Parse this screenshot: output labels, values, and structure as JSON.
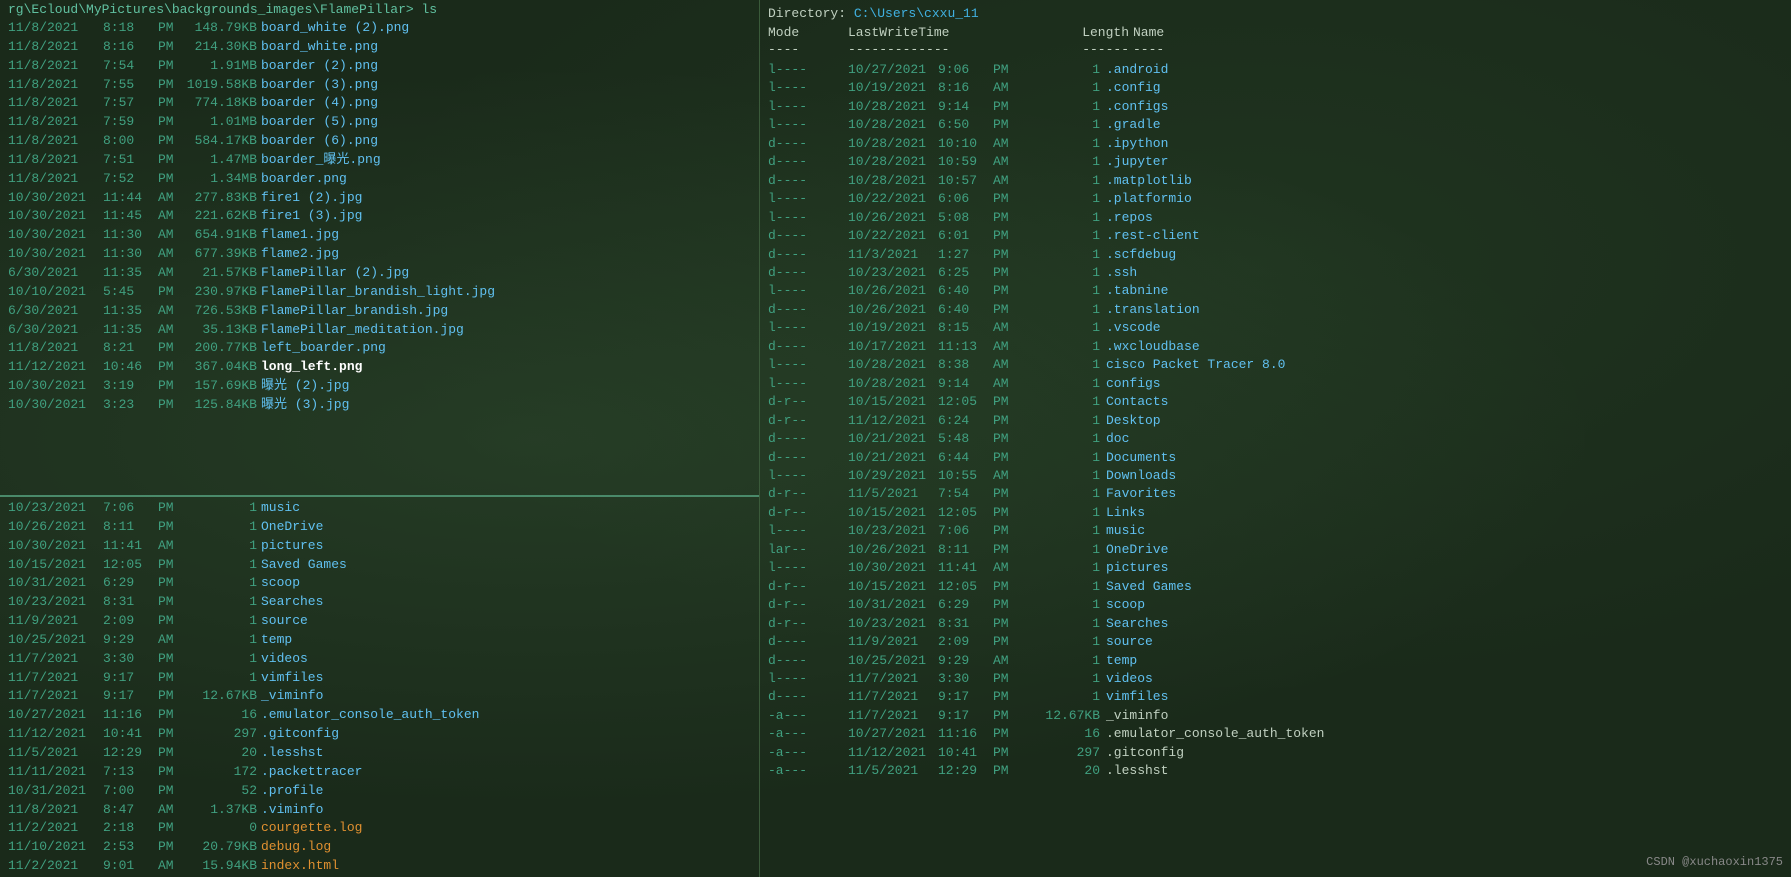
{
  "left_top": {
    "header": "rg\\Ecloud\\MyPictures\\backgrounds_images\\FlamePillar> ls",
    "files": [
      {
        "date": "11/8/2021",
        "time": "8:18",
        "ampm": "PM",
        "size": "148.79KB",
        "name": "board_white (2).png",
        "bold": false,
        "orange": false
      },
      {
        "date": "11/8/2021",
        "time": "8:16",
        "ampm": "PM",
        "size": "214.30KB",
        "name": "board_white.png",
        "bold": false,
        "orange": false
      },
      {
        "date": "11/8/2021",
        "time": "7:54",
        "ampm": "PM",
        "size": "1.91MB",
        "name": "boarder (2).png",
        "bold": false,
        "orange": false
      },
      {
        "date": "11/8/2021",
        "time": "7:55",
        "ampm": "PM",
        "size": "1019.58KB",
        "name": "boarder (3).png",
        "bold": false,
        "orange": false
      },
      {
        "date": "11/8/2021",
        "time": "7:57",
        "ampm": "PM",
        "size": "774.18KB",
        "name": "boarder (4).png",
        "bold": false,
        "orange": false
      },
      {
        "date": "11/8/2021",
        "time": "7:59",
        "ampm": "PM",
        "size": "1.01MB",
        "name": "boarder (5).png",
        "bold": false,
        "orange": false
      },
      {
        "date": "11/8/2021",
        "time": "8:00",
        "ampm": "PM",
        "size": "584.17KB",
        "name": "boarder (6).png",
        "bold": false,
        "orange": false
      },
      {
        "date": "11/8/2021",
        "time": "7:51",
        "ampm": "PM",
        "size": "1.47MB",
        "name": "boarder_曝光.png",
        "bold": false,
        "orange": false
      },
      {
        "date": "11/8/2021",
        "time": "7:52",
        "ampm": "PM",
        "size": "1.34MB",
        "name": "boarder.png",
        "bold": false,
        "orange": false
      },
      {
        "date": "10/30/2021",
        "time": "11:44",
        "ampm": "AM",
        "size": "277.83KB",
        "name": "fire1 (2).jpg",
        "bold": false,
        "orange": false
      },
      {
        "date": "10/30/2021",
        "time": "11:45",
        "ampm": "AM",
        "size": "221.62KB",
        "name": "fire1 (3).jpg",
        "bold": false,
        "orange": false
      },
      {
        "date": "10/30/2021",
        "time": "11:30",
        "ampm": "AM",
        "size": "654.91KB",
        "name": "flame1.jpg",
        "bold": false,
        "orange": false
      },
      {
        "date": "10/30/2021",
        "time": "11:30",
        "ampm": "AM",
        "size": "677.39KB",
        "name": "flame2.jpg",
        "bold": false,
        "orange": false
      },
      {
        "date": "6/30/2021",
        "time": "11:35",
        "ampm": "AM",
        "size": "21.57KB",
        "name": "FlamePillar (2).jpg",
        "bold": false,
        "orange": false
      },
      {
        "date": "10/10/2021",
        "time": "5:45",
        "ampm": "PM",
        "size": "230.97KB",
        "name": "FlamePillar_brandish_light.jpg",
        "bold": false,
        "orange": false
      },
      {
        "date": "6/30/2021",
        "time": "11:35",
        "ampm": "AM",
        "size": "726.53KB",
        "name": "FlamePillar_brandish.jpg",
        "bold": false,
        "orange": false
      },
      {
        "date": "6/30/2021",
        "time": "11:35",
        "ampm": "AM",
        "size": "35.13KB",
        "name": "FlamePillar_meditation.jpg",
        "bold": false,
        "orange": false
      },
      {
        "date": "11/8/2021",
        "time": "8:21",
        "ampm": "PM",
        "size": "200.77KB",
        "name": "left_boarder.png",
        "bold": false,
        "orange": false
      },
      {
        "date": "11/12/2021",
        "time": "10:46",
        "ampm": "PM",
        "size": "367.04KB",
        "name": "long_left.png",
        "bold": true,
        "orange": false
      },
      {
        "date": "10/30/2021",
        "time": "3:19",
        "ampm": "PM",
        "size": "157.69KB",
        "name": "曝光 (2).jpg",
        "bold": false,
        "orange": false
      },
      {
        "date": "10/30/2021",
        "time": "3:23",
        "ampm": "PM",
        "size": "125.84KB",
        "name": "曝光 (3).jpg",
        "bold": false,
        "orange": false
      }
    ]
  },
  "left_bottom": {
    "files": [
      {
        "date": "10/23/2021",
        "time": "7:06",
        "ampm": "PM",
        "size": "1",
        "name": "music",
        "bold": false,
        "orange": false
      },
      {
        "date": "10/26/2021",
        "time": "8:11",
        "ampm": "PM",
        "size": "1",
        "name": "OneDrive",
        "bold": false,
        "orange": false
      },
      {
        "date": "10/30/2021",
        "time": "11:41",
        "ampm": "AM",
        "size": "1",
        "name": "pictures",
        "bold": false,
        "orange": false
      },
      {
        "date": "10/15/2021",
        "time": "12:05",
        "ampm": "PM",
        "size": "1",
        "name": "Saved Games",
        "bold": false,
        "orange": false
      },
      {
        "date": "10/31/2021",
        "time": "6:29",
        "ampm": "PM",
        "size": "1",
        "name": "scoop",
        "bold": false,
        "orange": false
      },
      {
        "date": "10/23/2021",
        "time": "8:31",
        "ampm": "PM",
        "size": "1",
        "name": "Searches",
        "bold": false,
        "orange": false
      },
      {
        "date": "11/9/2021",
        "time": "2:09",
        "ampm": "PM",
        "size": "1",
        "name": "source",
        "bold": false,
        "orange": false
      },
      {
        "date": "10/25/2021",
        "time": "9:29",
        "ampm": "AM",
        "size": "1",
        "name": "temp",
        "bold": false,
        "orange": false
      },
      {
        "date": "11/7/2021",
        "time": "3:30",
        "ampm": "PM",
        "size": "1",
        "name": "videos",
        "bold": false,
        "orange": false
      },
      {
        "date": "11/7/2021",
        "time": "9:17",
        "ampm": "PM",
        "size": "1",
        "name": "vimfiles",
        "bold": false,
        "orange": false
      },
      {
        "date": "11/7/2021",
        "time": "9:17",
        "ampm": "PM",
        "size": "12.67KB",
        "name": "_viminfo",
        "bold": false,
        "orange": false
      },
      {
        "date": "10/27/2021",
        "time": "11:16",
        "ampm": "PM",
        "size": "16",
        "name": ".emulator_console_auth_token",
        "bold": false,
        "orange": false
      },
      {
        "date": "11/12/2021",
        "time": "10:41",
        "ampm": "PM",
        "size": "297",
        "name": ".gitconfig",
        "bold": false,
        "orange": false
      },
      {
        "date": "11/5/2021",
        "time": "12:29",
        "ampm": "PM",
        "size": "20",
        "name": ".lesshst",
        "bold": false,
        "orange": false
      },
      {
        "date": "11/11/2021",
        "time": "7:13",
        "ampm": "PM",
        "size": "172",
        "name": ".packettracer",
        "bold": false,
        "orange": false
      },
      {
        "date": "10/31/2021",
        "time": "7:00",
        "ampm": "PM",
        "size": "52",
        "name": ".profile",
        "bold": false,
        "orange": false
      },
      {
        "date": "11/8/2021",
        "time": "8:47",
        "ampm": "AM",
        "size": "1.37KB",
        "name": ".viminfo",
        "bold": false,
        "orange": false
      },
      {
        "date": "11/2/2021",
        "time": "2:18",
        "ampm": "PM",
        "size": "0",
        "name": "courgette.log",
        "bold": false,
        "orange": true
      },
      {
        "date": "11/10/2021",
        "time": "2:53",
        "ampm": "PM",
        "size": "20.79KB",
        "name": "debug.log",
        "bold": false,
        "orange": true
      },
      {
        "date": "11/2/2021",
        "time": "9:01",
        "ampm": "AM",
        "size": "15.94KB",
        "name": "index.html",
        "bold": false,
        "orange": true
      }
    ]
  },
  "right": {
    "directory_label": "Directory:",
    "directory_path": "C:\\Users\\cxxu_11",
    "headers": {
      "mode": "Mode",
      "lwt": "LastWriteTime",
      "length": "Length",
      "name": "Name"
    },
    "sep_mode": "----",
    "sep_lwt": "-------------",
    "sep_length": "------",
    "sep_name": "----",
    "rows": [
      {
        "mode": "l----",
        "date": "10/27/2021",
        "time": "9:06",
        "ampm": "PM",
        "len": "1",
        "name": ".android",
        "folder": true
      },
      {
        "mode": "l----",
        "date": "10/19/2021",
        "time": "8:16",
        "ampm": "AM",
        "len": "1",
        "name": ".config",
        "folder": true
      },
      {
        "mode": "l----",
        "date": "10/28/2021",
        "time": "9:14",
        "ampm": "PM",
        "len": "1",
        "name": ".configs",
        "folder": true
      },
      {
        "mode": "l----",
        "date": "10/28/2021",
        "time": "6:50",
        "ampm": "PM",
        "len": "1",
        "name": ".gradle",
        "folder": true
      },
      {
        "mode": "d----",
        "date": "10/28/2021",
        "time": "10:10",
        "ampm": "AM",
        "len": "1",
        "name": ".ipython",
        "folder": true
      },
      {
        "mode": "d----",
        "date": "10/28/2021",
        "time": "10:59",
        "ampm": "AM",
        "len": "1",
        "name": ".jupyter",
        "folder": true
      },
      {
        "mode": "d----",
        "date": "10/28/2021",
        "time": "10:57",
        "ampm": "AM",
        "len": "1",
        "name": ".matplotlib",
        "folder": true
      },
      {
        "mode": "l----",
        "date": "10/22/2021",
        "time": "6:06",
        "ampm": "PM",
        "len": "1",
        "name": ".platformio",
        "folder": true
      },
      {
        "mode": "l----",
        "date": "10/26/2021",
        "time": "5:08",
        "ampm": "PM",
        "len": "1",
        "name": ".repos",
        "folder": true
      },
      {
        "mode": "d----",
        "date": "10/22/2021",
        "time": "6:01",
        "ampm": "PM",
        "len": "1",
        "name": ".rest-client",
        "folder": true
      },
      {
        "mode": "d----",
        "date": "11/3/2021",
        "time": "1:27",
        "ampm": "PM",
        "len": "1",
        "name": ".scfdebug",
        "folder": true
      },
      {
        "mode": "d----",
        "date": "10/23/2021",
        "time": "6:25",
        "ampm": "PM",
        "len": "1",
        "name": ".ssh",
        "folder": true
      },
      {
        "mode": "l----",
        "date": "10/26/2021",
        "time": "6:40",
        "ampm": "PM",
        "len": "1",
        "name": ".tabnine",
        "folder": true
      },
      {
        "mode": "d----",
        "date": "10/26/2021",
        "time": "6:40",
        "ampm": "PM",
        "len": "1",
        "name": ".translation",
        "folder": true
      },
      {
        "mode": "l----",
        "date": "10/19/2021",
        "time": "8:15",
        "ampm": "AM",
        "len": "1",
        "name": ".vscode",
        "folder": true
      },
      {
        "mode": "d----",
        "date": "10/17/2021",
        "time": "11:13",
        "ampm": "AM",
        "len": "1",
        "name": ".wxcloudbase",
        "folder": true
      },
      {
        "mode": "l----",
        "date": "10/28/2021",
        "time": "8:38",
        "ampm": "AM",
        "len": "1",
        "name": "cisco Packet Tracer 8.0",
        "folder": true
      },
      {
        "mode": "l----",
        "date": "10/28/2021",
        "time": "9:14",
        "ampm": "AM",
        "len": "1",
        "name": "configs",
        "folder": true
      },
      {
        "mode": "d-r--",
        "date": "10/15/2021",
        "time": "12:05",
        "ampm": "PM",
        "len": "1",
        "name": "Contacts",
        "folder": true
      },
      {
        "mode": "d-r--",
        "date": "11/12/2021",
        "time": "6:24",
        "ampm": "PM",
        "len": "1",
        "name": "Desktop",
        "folder": true
      },
      {
        "mode": "d----",
        "date": "10/21/2021",
        "time": "5:48",
        "ampm": "PM",
        "len": "1",
        "name": "doc",
        "folder": true
      },
      {
        "mode": "d----",
        "date": "10/21/2021",
        "time": "6:44",
        "ampm": "PM",
        "len": "1",
        "name": "Documents",
        "folder": true
      },
      {
        "mode": "l----",
        "date": "10/29/2021",
        "time": "10:55",
        "ampm": "AM",
        "len": "1",
        "name": "Downloads",
        "folder": true
      },
      {
        "mode": "d-r--",
        "date": "11/5/2021",
        "time": "7:54",
        "ampm": "PM",
        "len": "1",
        "name": "Favorites",
        "folder": true
      },
      {
        "mode": "d-r--",
        "date": "10/15/2021",
        "time": "12:05",
        "ampm": "PM",
        "len": "1",
        "name": "Links",
        "folder": true
      },
      {
        "mode": "l----",
        "date": "10/23/2021",
        "time": "7:06",
        "ampm": "PM",
        "len": "1",
        "name": "music",
        "folder": true
      },
      {
        "mode": "lar--",
        "date": "10/26/2021",
        "time": "8:11",
        "ampm": "PM",
        "len": "1",
        "name": "OneDrive",
        "folder": true
      },
      {
        "mode": "l----",
        "date": "10/30/2021",
        "time": "11:41",
        "ampm": "AM",
        "len": "1",
        "name": "pictures",
        "folder": true
      },
      {
        "mode": "d-r--",
        "date": "10/15/2021",
        "time": "12:05",
        "ampm": "PM",
        "len": "1",
        "name": "Saved Games",
        "folder": true
      },
      {
        "mode": "d-r--",
        "date": "10/31/2021",
        "time": "6:29",
        "ampm": "PM",
        "len": "1",
        "name": "scoop",
        "folder": true
      },
      {
        "mode": "d-r--",
        "date": "10/23/2021",
        "time": "8:31",
        "ampm": "PM",
        "len": "1",
        "name": "Searches",
        "folder": true
      },
      {
        "mode": "d----",
        "date": "11/9/2021",
        "time": "2:09",
        "ampm": "PM",
        "len": "1",
        "name": "source",
        "folder": true
      },
      {
        "mode": "d----",
        "date": "10/25/2021",
        "time": "9:29",
        "ampm": "AM",
        "len": "1",
        "name": "temp",
        "folder": true
      },
      {
        "mode": "l----",
        "date": "11/7/2021",
        "time": "3:30",
        "ampm": "PM",
        "len": "1",
        "name": "videos",
        "folder": true
      },
      {
        "mode": "d----",
        "date": "11/7/2021",
        "time": "9:17",
        "ampm": "PM",
        "len": "1",
        "name": "vimfiles",
        "folder": true
      },
      {
        "mode": "-a---",
        "date": "11/7/2021",
        "time": "9:17",
        "ampm": "PM",
        "len": "12.67KB",
        "name": "_viminfo",
        "folder": false
      },
      {
        "mode": "-a---",
        "date": "10/27/2021",
        "time": "11:16",
        "ampm": "PM",
        "len": "16",
        "name": ".emulator_console_auth_token",
        "folder": false
      },
      {
        "mode": "-a---",
        "date": "11/12/2021",
        "time": "10:41",
        "ampm": "PM",
        "len": "297",
        "name": ".gitconfig",
        "folder": false
      },
      {
        "mode": "-a---",
        "date": "11/5/2021",
        "time": "12:29",
        "ampm": "PM",
        "len": "20",
        "name": ".lesshst",
        "folder": false
      }
    ]
  },
  "watermark": "CSDN @xuchaoxin1375"
}
